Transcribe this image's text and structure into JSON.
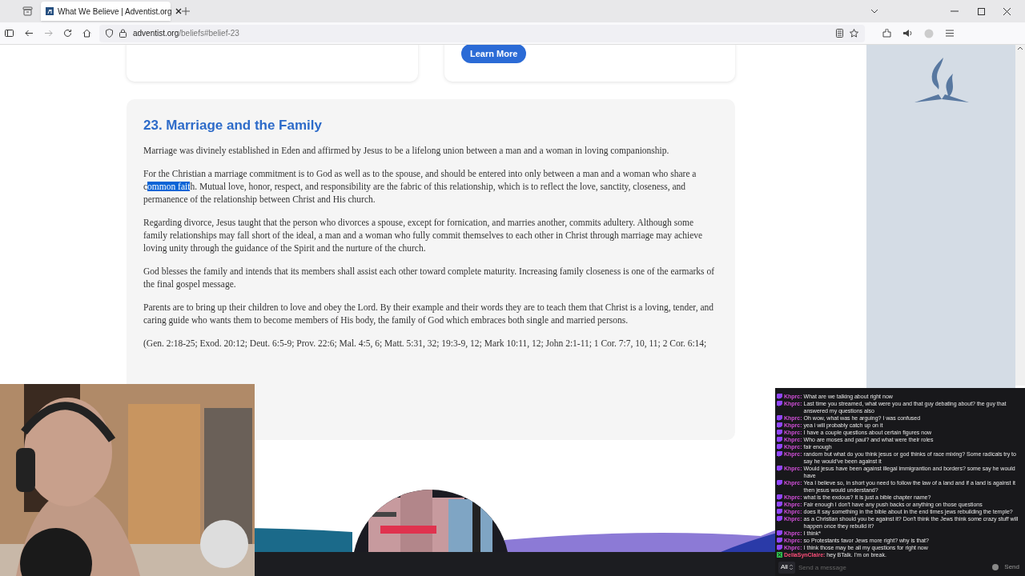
{
  "browser": {
    "tab_title": "What We Believe | Adventist.org",
    "url_host": "adventist.org",
    "url_path": "/beliefs#belief-23"
  },
  "page": {
    "top_button": "Learn More",
    "heading": "23. Marriage and the Family",
    "paragraphs": [
      {
        "text": "Marriage was divinely established in Eden and affirmed by Jesus to be a lifelong union between a man and a woman in loving companionship."
      },
      {
        "text": "For the Christian a marriage commitment is to God as well as to the spouse, and should be entered into only between a man and a woman who share a c",
        "selection": "ommon fait",
        "text_after": "h. Mutual love, honor, respect, and responsibility are the fabric of this relationship, which is to reflect the love, sanctity, closeness, and permanence of the relationship between Christ and His church."
      },
      {
        "text": "Regarding divorce, Jesus taught that the person who divorces a spouse, except for fornication, and marries another, commits adultery. Although some family relationships may fall short of the ideal, a man and a woman who fully commit themselves to each other in Christ through marriage may achieve loving unity through the guidance of the Spirit and the nurture of the church."
      },
      {
        "text": "God blesses the family and intends that its members shall assist each other toward complete maturity. Increasing family closeness is one of the earmarks of the final gospel message."
      },
      {
        "text": "Parents are to bring up their children to love and obey the Lord. By their example and their words they are to teach them that Christ is a loving, tender, and caring guide who wants them to become members of His body, the family of God which embraces both single and married persons."
      }
    ],
    "citation": "(Gen. 2:18-25; Exod. 20:12; Deut. 6:5-9; Prov. 22:6; Mal. 4:5, 6; Matt. 5:31, 32; 19:3-9, 12; Mark 10:11, 12; John 2:1-11; 1 Cor. 7:7, 10, 11; 2 Cor. 6:14;"
  },
  "chat": {
    "messages": [
      {
        "kind": "glitch",
        "user": "Khprc:",
        "color": "#d04fd8",
        "text": "What are we talking about right now"
      },
      {
        "kind": "glitch",
        "user": "Khprc:",
        "color": "#d04fd8",
        "text": "Last time you streamed, what were you and that guy debating about? the guy that answered my questions also"
      },
      {
        "kind": "glitch",
        "user": "Khprc:",
        "color": "#d04fd8",
        "text": "Oh wow, what was he arguing? I was confused"
      },
      {
        "kind": "glitch",
        "user": "Khprc:",
        "color": "#d04fd8",
        "text": "yea i will probably catch up on it"
      },
      {
        "kind": "glitch",
        "user": "Khprc:",
        "color": "#d04fd8",
        "text": "I have a couple questions about certain figures now"
      },
      {
        "kind": "glitch",
        "user": "Khprc:",
        "color": "#d04fd8",
        "text": "Who are moses and paul? and what were their roles"
      },
      {
        "kind": "glitch",
        "user": "Khprc:",
        "color": "#d04fd8",
        "text": "fair enough"
      },
      {
        "kind": "glitch",
        "user": "Khprc:",
        "color": "#d04fd8",
        "text": "random but what do you think jesus or god thinks of race mixing? Some radicals try to say he would've been against it"
      },
      {
        "kind": "glitch",
        "user": "Khprc:",
        "color": "#d04fd8",
        "text": "Would jesus have been against illegal immigrantion and borders? some say he would have"
      },
      {
        "kind": "glitch",
        "user": "Khprc:",
        "color": "#d04fd8",
        "text": "Yea I believe so, in short you need to follow the law of a land and if a land is against it then jesus would understand?"
      },
      {
        "kind": "glitch",
        "user": "Khprc:",
        "color": "#d04fd8",
        "text": "what is the exdous? It is just a bible chapter name?"
      },
      {
        "kind": "glitch",
        "user": "Khprc:",
        "color": "#d04fd8",
        "text": "Fair enough I don't have any push backs or anything on those questions"
      },
      {
        "kind": "glitch",
        "user": "Khprc:",
        "color": "#d04fd8",
        "text": "does it say something in the bible about in the end times jews rebuilding the temple?"
      },
      {
        "kind": "glitch",
        "user": "Khprc:",
        "color": "#d04fd8",
        "text": "as a Christian should you be against it? Don't think the Jews think some crazy stuff will happen once they rebuild it?"
      },
      {
        "kind": "glitch",
        "user": "Khprc:",
        "color": "#d04fd8",
        "text": "I think*"
      },
      {
        "kind": "glitch",
        "user": "Khprc:",
        "color": "#d04fd8",
        "text": "so Protestants favor Jews more right? why is that?"
      },
      {
        "kind": "glitch",
        "user": "Khprc:",
        "color": "#d04fd8",
        "text": "I think those may be all my questions for right now"
      },
      {
        "kind": "cross",
        "user": "DeliaSynClaire:",
        "color": "#ff4f7a",
        "text": "hey BTalk. I'm on break."
      }
    ],
    "filter": "All",
    "placeholder": "Send a message",
    "send": "Send"
  }
}
